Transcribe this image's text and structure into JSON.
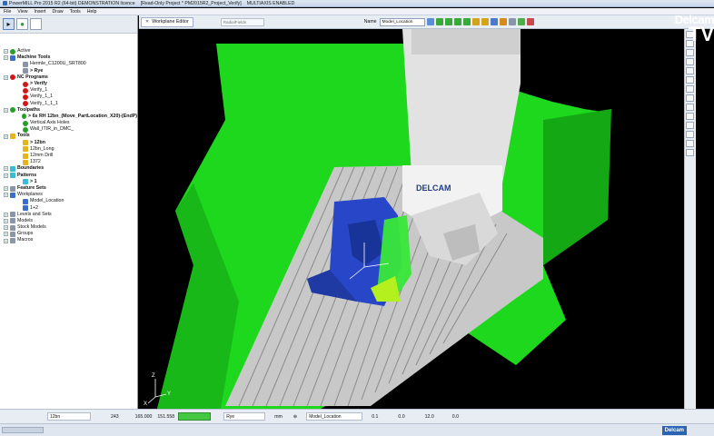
{
  "window": {
    "title": "PowerMILL Pro 2015 R2 (64-bit) DEMONSTRATION licence",
    "project": "[Read-Only Project * PM2015R2_Project_Verify]",
    "mode": "MULTIAXIS ENABLED"
  },
  "menu": [
    "File",
    "View",
    "Insert",
    "Draw",
    "Tools",
    "Help"
  ],
  "explorer": {
    "tabs": [
      "explorer-tab",
      "models-tab",
      "blank-tab"
    ],
    "tree": [
      {
        "label": "Active",
        "level": 0,
        "icon": "dot-green",
        "bold": false
      },
      {
        "label": "Machine Tools",
        "level": 0,
        "icon": "sq-blue",
        "bold": true
      },
      {
        "label": "Hermle_C1200U_SRT800",
        "level": 1,
        "icon": "sq-gray",
        "bold": false
      },
      {
        "label": "> Rye",
        "level": 1,
        "icon": "sq-gray",
        "bold": true
      },
      {
        "label": "NC Programs",
        "level": 0,
        "icon": "dot-red",
        "bold": true
      },
      {
        "label": "> Verify",
        "level": 1,
        "icon": "dot-red",
        "bold": true
      },
      {
        "label": "Verify_1",
        "level": 1,
        "icon": "dot-red",
        "bold": false
      },
      {
        "label": "Verify_1_1",
        "level": 1,
        "icon": "dot-red",
        "bold": false
      },
      {
        "label": "Verify_1_1_1",
        "level": 1,
        "icon": "dot-red",
        "bold": false
      },
      {
        "label": "Toolpaths",
        "level": 0,
        "icon": "dot-green",
        "bold": true
      },
      {
        "label": "> 6s RH 12bn_(Move_PartLocation_X20)-(EndP)",
        "level": 1,
        "icon": "dot-green",
        "bold": true
      },
      {
        "label": "Vertical Axis Holes",
        "level": 1,
        "icon": "dot-green",
        "bold": false
      },
      {
        "label": "Wall_ITIR_in_DMC_",
        "level": 1,
        "icon": "dot-green",
        "bold": false
      },
      {
        "label": "Tools",
        "level": 0,
        "icon": "sq-yellow",
        "bold": true
      },
      {
        "label": "> 12bn",
        "level": 1,
        "icon": "sq-yellow",
        "bold": true
      },
      {
        "label": "12bn_Long",
        "level": 1,
        "icon": "sq-yellow",
        "bold": false
      },
      {
        "label": "12mm Drill",
        "level": 1,
        "icon": "sq-yellow",
        "bold": false
      },
      {
        "label": "1372",
        "level": 1,
        "icon": "sq-yellow",
        "bold": false
      },
      {
        "label": "Boundaries",
        "level": 0,
        "icon": "sq-cyan",
        "bold": true
      },
      {
        "label": "Patterns",
        "level": 0,
        "icon": "sq-cyan",
        "bold": true
      },
      {
        "label": "> 1",
        "level": 1,
        "icon": "sq-cyan",
        "bold": true
      },
      {
        "label": "Feature Sets",
        "level": 0,
        "icon": "sq-gray",
        "bold": true
      },
      {
        "label": "Workplanes",
        "level": 0,
        "icon": "sq-blue",
        "bold": false
      },
      {
        "label": "Model_Location",
        "level": 1,
        "icon": "sq-blue",
        "bold": false
      },
      {
        "label": "1+2",
        "level": 1,
        "icon": "sq-blue",
        "bold": false
      },
      {
        "label": "Levels and Sets",
        "level": 0,
        "icon": "sq-gray",
        "bold": false
      },
      {
        "label": "Models",
        "level": 0,
        "icon": "sq-gray",
        "bold": false
      },
      {
        "label": "Stock Models",
        "level": 0,
        "icon": "sq-gray",
        "bold": false
      },
      {
        "label": "Groups",
        "level": 0,
        "icon": "sq-gray",
        "bold": false
      },
      {
        "label": "Macros",
        "level": 0,
        "icon": "sq-gray",
        "bold": false
      }
    ]
  },
  "viewport_toolbar": {
    "tab_label": "Workplane Editor",
    "tool_select": "RadialFields",
    "name_label": "Name",
    "name_value": "Model_Location"
  },
  "viewport": {
    "brand_text": "DELCAM",
    "axis_labels": [
      "Z",
      "Y",
      "X"
    ]
  },
  "logo": {
    "line1": "Delcam",
    "line2": "TV"
  },
  "statusbar": {
    "tool": "12bn",
    "coord1": "243",
    "coord2": "165.000",
    "coord3": "151.558",
    "machine": "Rye",
    "units": "mm",
    "workplane": "Model_Location",
    "tol": "0.1",
    "thick": "0.0",
    "stepover": "12.0",
    "stepdown": "0.0"
  },
  "footer": {
    "brand": "Delcam"
  },
  "colors": {
    "machine_green": "#1fd81f",
    "part_blue": "#2847c8",
    "bed_gray": "#c8c8c8"
  }
}
